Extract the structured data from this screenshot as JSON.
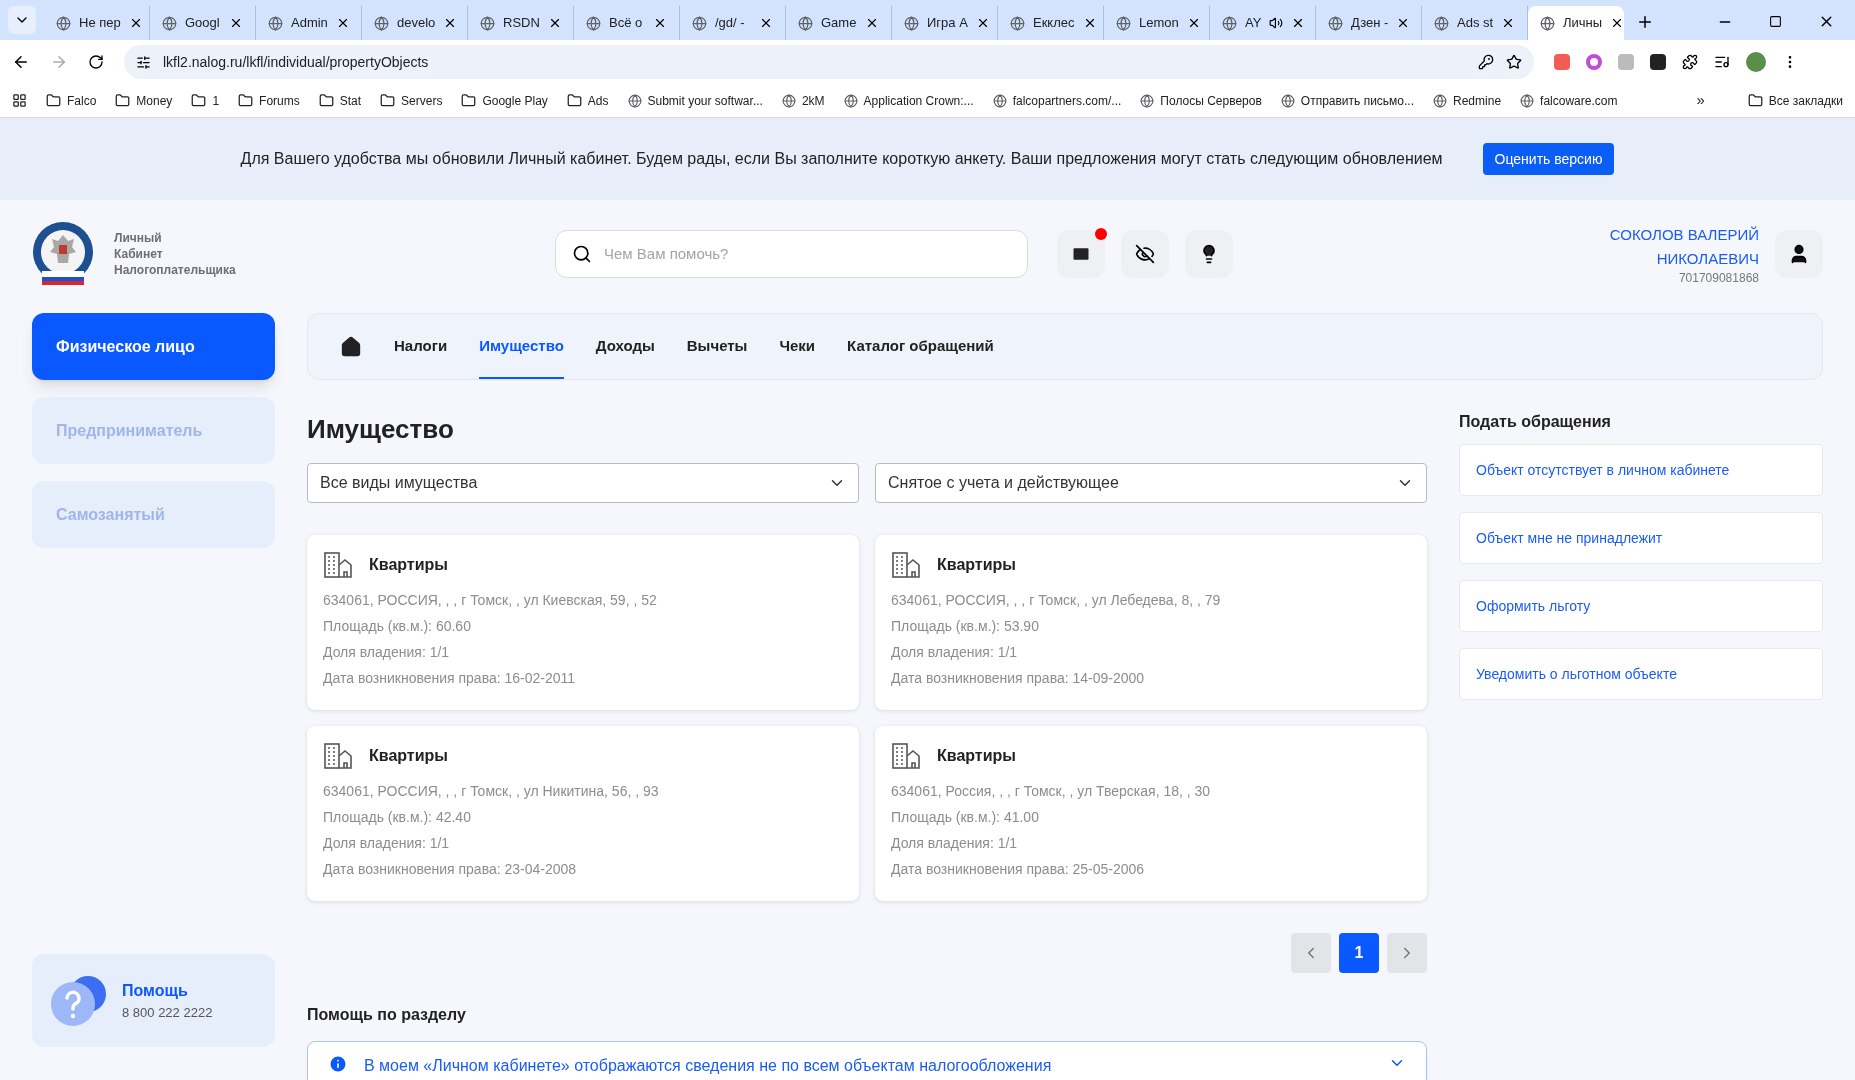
{
  "browser": {
    "tabs": [
      {
        "title": "Не пер",
        "selected": false
      },
      {
        "title": "Googl",
        "selected": false
      },
      {
        "title": "Admin",
        "selected": false
      },
      {
        "title": "develo",
        "selected": false
      },
      {
        "title": "RSDN",
        "selected": false
      },
      {
        "title": "Всё о",
        "selected": false
      },
      {
        "title": "/gd/ -",
        "selected": false
      },
      {
        "title": "Game",
        "selected": false
      },
      {
        "title": "Игра А",
        "selected": false
      },
      {
        "title": "Екклес",
        "selected": false
      },
      {
        "title": "Lemon",
        "selected": false
      },
      {
        "title": "AY",
        "selected": false,
        "audio": true
      },
      {
        "title": "Дзен -",
        "selected": false
      },
      {
        "title": "Ads st",
        "selected": false
      },
      {
        "title": "Личны",
        "selected": true
      }
    ],
    "url": "lkfl2.nalog.ru/lkfl/individual/propertyObjects",
    "bookmarks": [
      {
        "label": "Falco",
        "kind": "folder"
      },
      {
        "label": "Money",
        "kind": "folder"
      },
      {
        "label": "1",
        "kind": "folder"
      },
      {
        "label": "Forums",
        "kind": "folder"
      },
      {
        "label": "Stat",
        "kind": "folder"
      },
      {
        "label": "Servers",
        "kind": "folder"
      },
      {
        "label": "Google Play",
        "kind": "folder"
      },
      {
        "label": "Ads",
        "kind": "folder"
      },
      {
        "label": "Submit your softwar...",
        "kind": "link"
      },
      {
        "label": "2kM",
        "kind": "link"
      },
      {
        "label": "Application Crown:...",
        "kind": "link"
      },
      {
        "label": "falcopartners.com/...",
        "kind": "link"
      },
      {
        "label": "Полосы Серверов",
        "kind": "link"
      },
      {
        "label": "Отправить письмо...",
        "kind": "link"
      },
      {
        "label": "Redmine",
        "kind": "link"
      },
      {
        "label": "falcoware.com",
        "kind": "link"
      }
    ],
    "more": "»",
    "all_bookmarks": "Все закладки"
  },
  "banner": {
    "text": "Для Вашего удобства мы обновили Личный кабинет. Будем рады, если Вы заполните короткую анкету. Ваши предложения могут стать следующим обновлением",
    "button": "Оценить версию"
  },
  "header": {
    "logo_lines": [
      "Личный",
      "Кабинет",
      "Налогоплательщика"
    ],
    "search": {
      "placeholder": "Чем Вам помочь?"
    },
    "mail_unread": true,
    "user": {
      "name_lines": [
        "СОКОЛОВ ВАЛЕРИЙ",
        "НИКОЛАЕВИЧ"
      ],
      "inn": "701709081868"
    }
  },
  "sidebar": {
    "items": [
      {
        "label": "Физическое лицо",
        "selected": true
      },
      {
        "label": "Предприниматель",
        "selected": false
      },
      {
        "label": "Самозанятый",
        "selected": false
      }
    ],
    "help": {
      "title": "Помощь",
      "phone": "8 800 222 2222"
    }
  },
  "nav": {
    "tabs": [
      {
        "label": "Налоги",
        "selected": false
      },
      {
        "label": "Имущество",
        "selected": true
      },
      {
        "label": "Доходы",
        "selected": false
      },
      {
        "label": "Вычеты",
        "selected": false
      },
      {
        "label": "Чеки",
        "selected": false
      },
      {
        "label": "Каталог обращений",
        "selected": false
      }
    ]
  },
  "main": {
    "title": "Имущество",
    "filters": [
      "Все виды имущества",
      "Снятое с учета и действующее"
    ],
    "properties": [
      {
        "type": "Квартиры",
        "lines": [
          "634061, РОССИЯ, , , г Томск, , ул Киевская, 59, , 52",
          "Площадь (кв.м.): 60.60",
          "Доля владения: 1/1",
          "Дата возникновения права: 16-02-2011"
        ]
      },
      {
        "type": "Квартиры",
        "lines": [
          "634061, РОССИЯ, , , г Томск, , ул Лебедева, 8, , 79",
          "Площадь (кв.м.): 53.90",
          "Доля владения: 1/1",
          "Дата возникновения права: 14-09-2000"
        ]
      },
      {
        "type": "Квартиры",
        "lines": [
          "634061, РОССИЯ, , , г Томск, , ул Никитина, 56, , 93",
          "Площадь (кв.м.): 42.40",
          "Доля владения: 1/1",
          "Дата возникновения права: 23-04-2008"
        ]
      },
      {
        "type": "Квартиры",
        "lines": [
          "634061, Россия, , , г Томск, , ул Тверская, 18, , 30",
          "Площадь (кв.м.): 41.00",
          "Доля владения: 1/1",
          "Дата возникновения права: 25-05-2006"
        ]
      }
    ],
    "pages": [
      {
        "label": "1",
        "selected": true
      }
    ],
    "help_title": "Помощь по разделу",
    "help_items": [
      {
        "text": "В моем «Личном кабинете» отображаются сведения не по всем объектам налогообложения",
        "expanded": false
      }
    ]
  },
  "requests": {
    "title": "Подать обращения",
    "links": [
      "Объект отсутствует в личном кабинете",
      "Объект мне не принадлежит",
      "Оформить льготу",
      "Уведомить о льготном объекте"
    ]
  }
}
